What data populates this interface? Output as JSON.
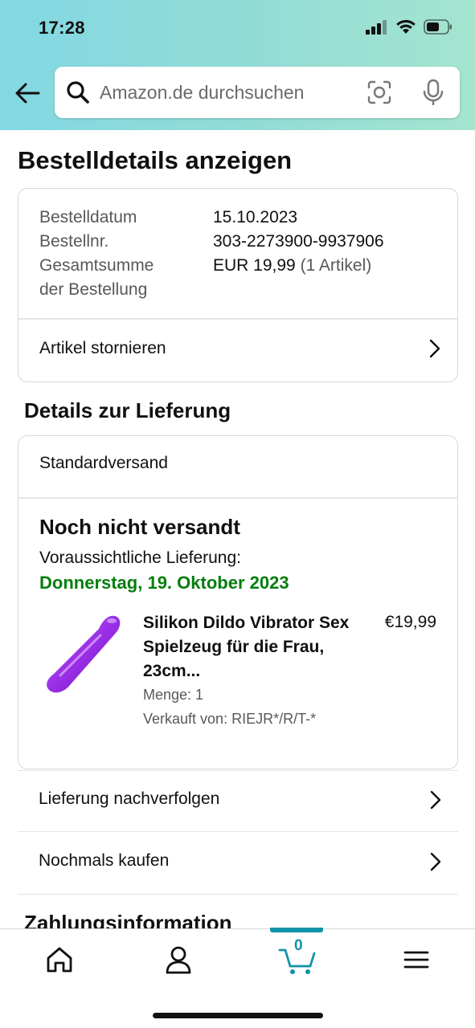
{
  "status_bar": {
    "time": "17:28"
  },
  "search": {
    "placeholder": "Amazon.de durchsuchen"
  },
  "page_title": "Bestelldetails anzeigen",
  "summary": {
    "order_date_label": "Bestelldatum",
    "order_date": "15.10.2023",
    "order_number_label": "Bestellnr.",
    "order_number": "303-2273900-9937906",
    "total_label_line1": "Gesamtsumme",
    "total_label_line2": "der Bestellung",
    "total_value": "EUR 19,99",
    "total_items": "(1 Artikel)",
    "cancel_link": "Artikel stornieren"
  },
  "delivery": {
    "section_title": "Details zur Lieferung",
    "shipping_method": "Standardversand",
    "status": "Noch nicht versandt",
    "eta_label": "Voraussichtliche Lieferung:",
    "eta_date": "Donnerstag, 19. Oktober 2023",
    "item": {
      "title": "Silikon Dildo Vibrator Sex Spielzeug für die Frau, 23cm...",
      "price": "€19,99",
      "quantity": "Menge: 1",
      "seller": "Verkauft von: RIEJR*/R/T-*",
      "image_color": "#9a2fe6"
    }
  },
  "actions": {
    "track": "Lieferung nachverfolgen",
    "buy_again": "Nochmals kaufen"
  },
  "payment": {
    "section_title": "Zahlungsinformation"
  },
  "bottom_nav": {
    "cart_count": "0",
    "accent": "#1192a7"
  },
  "colors": {
    "delivery_green": "#067d0e",
    "header_start": "#82d8e3",
    "header_end": "#a5e5cf"
  }
}
